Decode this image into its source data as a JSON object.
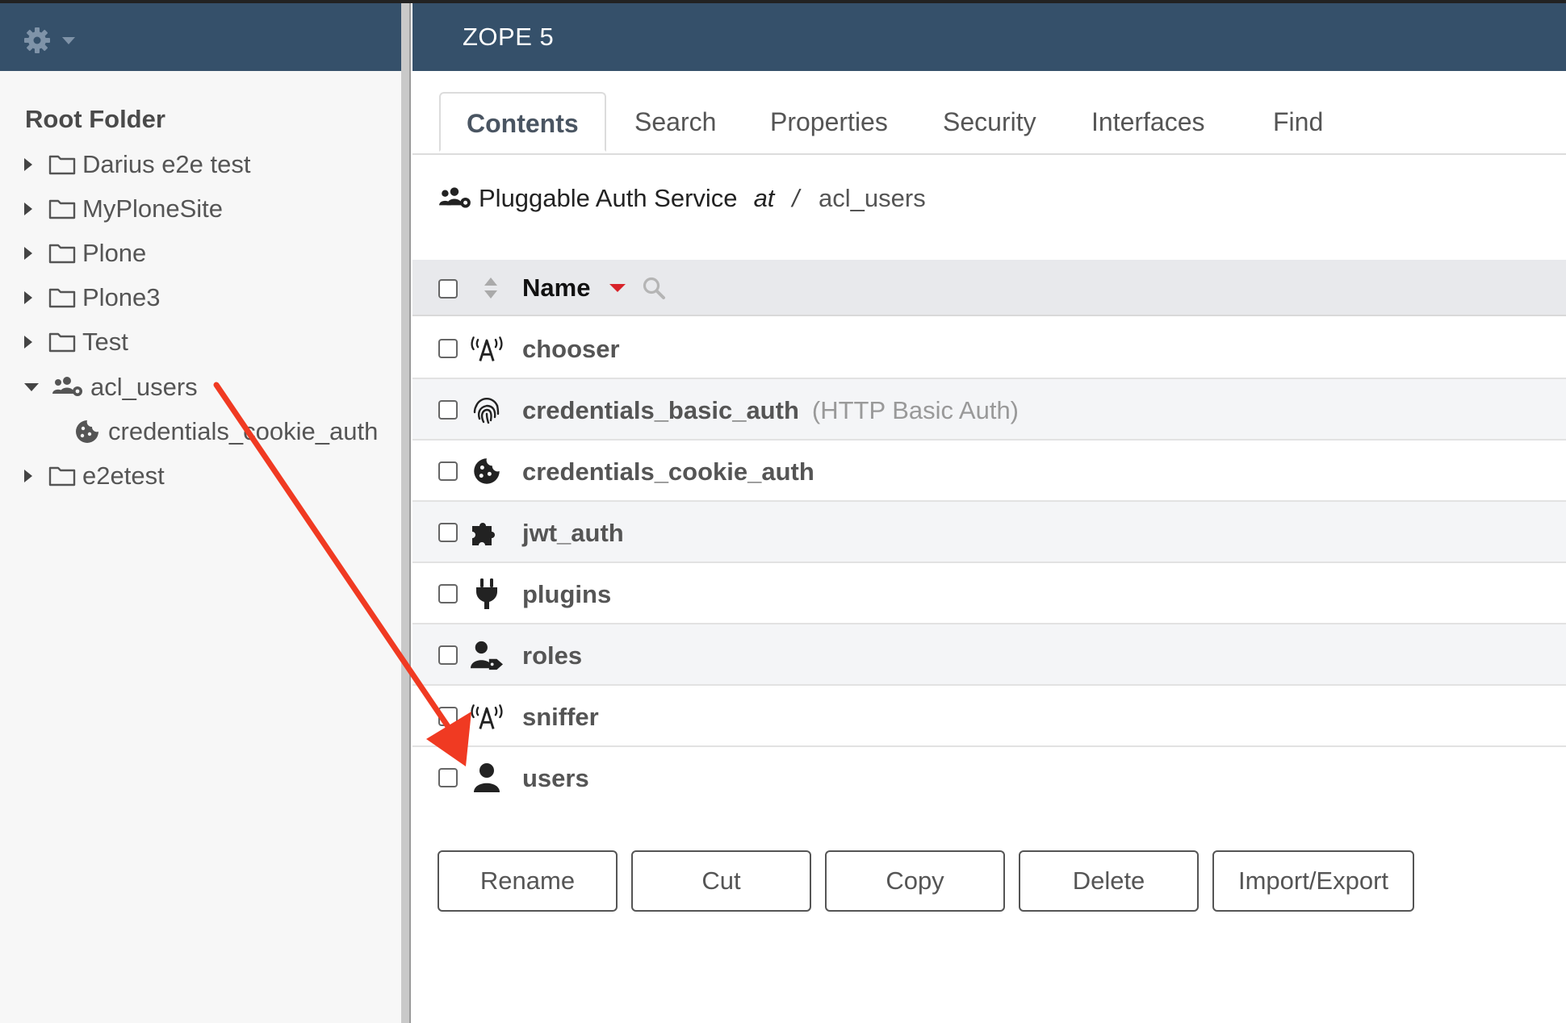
{
  "app": {
    "brand": "ZOPE 5"
  },
  "nav": {
    "root_label": "Root Folder",
    "items": [
      {
        "label": "Darius e2e test"
      },
      {
        "label": "MyPloneSite"
      },
      {
        "label": "Plone"
      },
      {
        "label": "Plone3"
      },
      {
        "label": "Test"
      },
      {
        "label": "acl_users",
        "expanded": true
      },
      {
        "label": "credentials_cookie_auth"
      },
      {
        "label": "e2etest"
      }
    ]
  },
  "tabs": [
    {
      "label": "Contents",
      "active": true
    },
    {
      "label": "Search"
    },
    {
      "label": "Properties"
    },
    {
      "label": "Security"
    },
    {
      "label": "Interfaces"
    },
    {
      "label": "Find"
    }
  ],
  "breadcrumb": {
    "type": "Pluggable Auth Service",
    "at": "at",
    "separator": "/",
    "path": "acl_users"
  },
  "table": {
    "name_header": "Name",
    "rows": [
      {
        "name": "chooser",
        "icon": "radio-tower-icon"
      },
      {
        "name": "credentials_basic_auth",
        "subtitle": "(HTTP Basic Auth)",
        "icon": "fingerprint-icon"
      },
      {
        "name": "credentials_cookie_auth",
        "icon": "cookie-icon"
      },
      {
        "name": "jwt_auth",
        "icon": "puzzle-icon"
      },
      {
        "name": "plugins",
        "icon": "plug-icon"
      },
      {
        "name": "roles",
        "icon": "user-tag-icon"
      },
      {
        "name": "sniffer",
        "icon": "radio-tower-icon"
      },
      {
        "name": "users",
        "icon": "user-icon"
      }
    ]
  },
  "actions": {
    "rename": "Rename",
    "cut": "Cut",
    "copy": "Copy",
    "delete": "Delete",
    "import_export": "Import/Export"
  },
  "colors": {
    "header_bg": "#35506a",
    "annotation_arrow": "#f03a22",
    "sort_caret": "#d8232a"
  }
}
